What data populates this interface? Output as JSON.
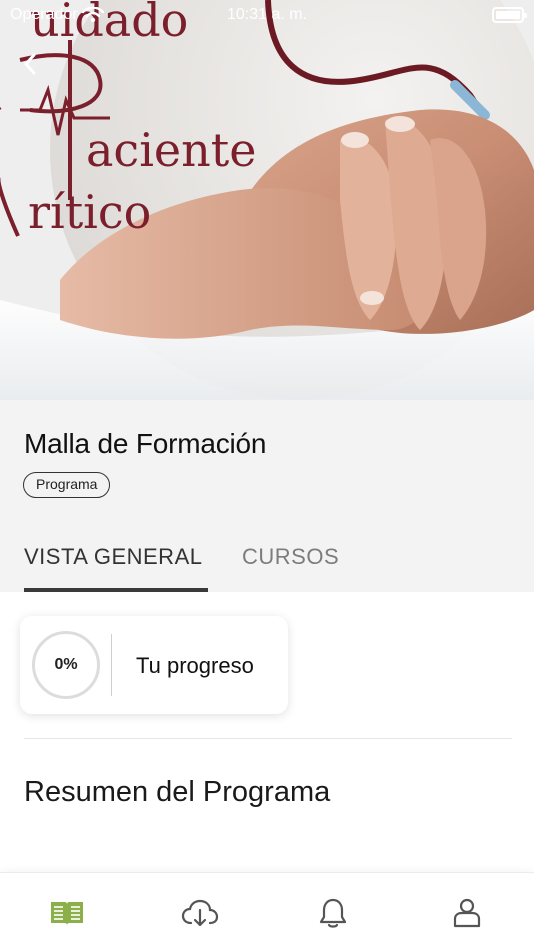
{
  "status_bar": {
    "carrier": "Operador",
    "time": "10:31 a. m."
  },
  "hero": {
    "image_text_line1": "uidado",
    "image_text_line2": "aciente",
    "image_text_line3": "rítico",
    "accent_color": "#7a1f2b"
  },
  "header": {
    "title": "Malla de Formación",
    "badge": "Programa"
  },
  "tabs": [
    {
      "label": "VISTA GENERAL",
      "active": true
    },
    {
      "label": "CURSOS",
      "active": false
    }
  ],
  "progress": {
    "value_label": "0%",
    "value": 0,
    "label": "Tu progreso"
  },
  "summary": {
    "title": "Resumen del Programa"
  },
  "bottom_nav": {
    "items": [
      {
        "icon": "book-icon",
        "active": true,
        "color": "#8bb04a"
      },
      {
        "icon": "cloud-download-icon",
        "active": false
      },
      {
        "icon": "bell-icon",
        "active": false
      },
      {
        "icon": "user-icon",
        "active": false
      }
    ]
  }
}
